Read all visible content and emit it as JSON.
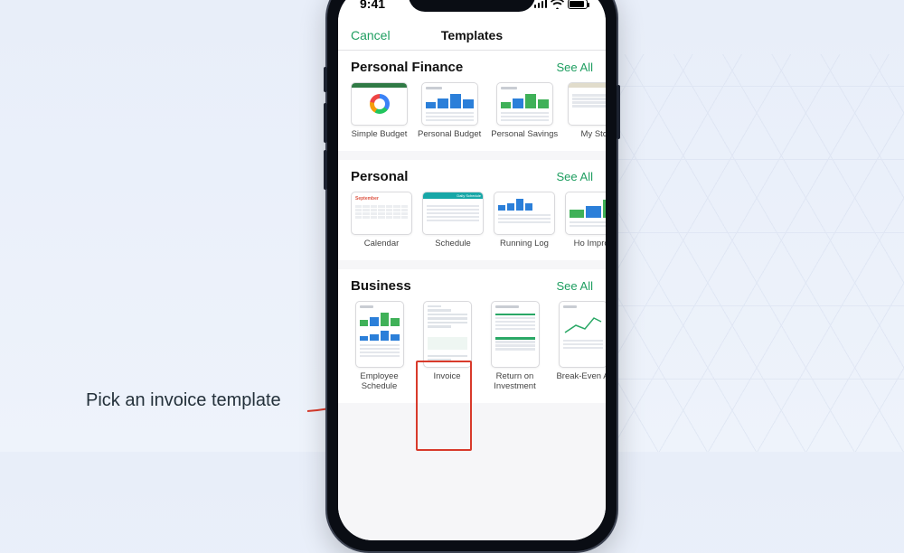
{
  "annotation": "Pick an invoice template",
  "status": {
    "time": "9:41"
  },
  "nav": {
    "cancel": "Cancel",
    "title": "Templates"
  },
  "see_all": "See All",
  "sections": {
    "finance": {
      "title": "Personal Finance",
      "items": [
        "Simple Budget",
        "Personal Budget",
        "Personal Savings",
        "My Stoc"
      ]
    },
    "personal": {
      "title": "Personal",
      "items": [
        "Calendar",
        "Schedule",
        "Running Log",
        "Ho\nImprov"
      ]
    },
    "business": {
      "title": "Business",
      "items": [
        "Employee Schedule",
        "Invoice",
        "Return on Investment",
        "Break-Even A"
      ]
    }
  },
  "colors": {
    "accent": "#1e9e60",
    "highlight": "#d83a2b"
  }
}
